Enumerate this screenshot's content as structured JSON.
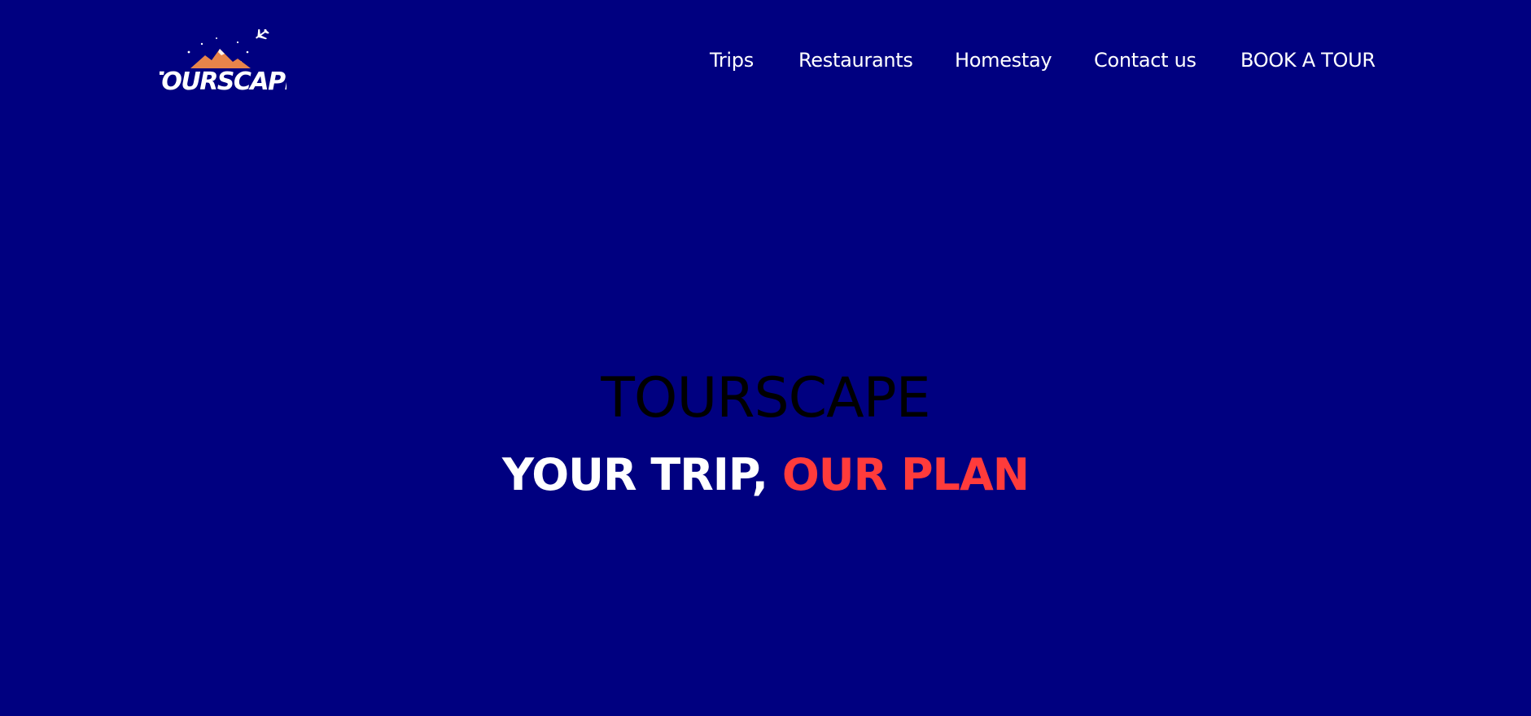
{
  "brand": {
    "logo_text": "TOURSCAPE",
    "colors": {
      "background": "#000080",
      "accent": "#ff3b3b",
      "mountain": "#e8844a",
      "text": "#ffffff"
    }
  },
  "nav": {
    "items": [
      {
        "label": "Trips"
      },
      {
        "label": "Restaurants"
      },
      {
        "label": "Homestay"
      },
      {
        "label": "Contact us"
      },
      {
        "label": "BOOK A TOUR"
      }
    ]
  },
  "hero": {
    "title": "TOURSCAPE",
    "tagline_part1": "YOUR TRIP, ",
    "tagline_part2": "OUR PLAN"
  },
  "icons": {
    "logo_mountain": "mountain-icon",
    "logo_plane": "airplane-icon"
  }
}
